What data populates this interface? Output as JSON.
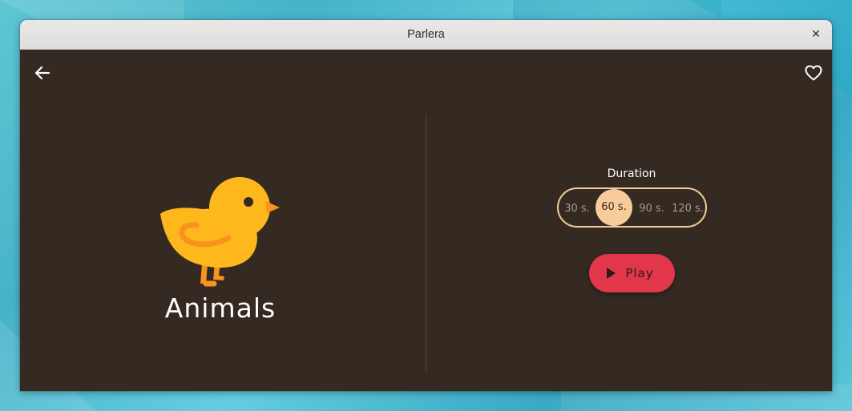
{
  "window": {
    "title": "Parlera"
  },
  "header": {
    "back_icon": "arrow-left-icon",
    "favorite_icon": "heart-outline-icon"
  },
  "category": {
    "name": "Animals",
    "image_icon": "chick-icon"
  },
  "duration": {
    "label": "Duration",
    "options": [
      "30 s.",
      "60 s.",
      "90 s.",
      "120 s."
    ],
    "selected": "60 s."
  },
  "actions": {
    "play_label": "Play",
    "play_icon": "play-icon"
  },
  "colors": {
    "background": "#342a22",
    "accent": "#f6cc9a",
    "play": "#e2374a",
    "chick_body": "#ffb81c",
    "chick_beak": "#f7931e"
  }
}
